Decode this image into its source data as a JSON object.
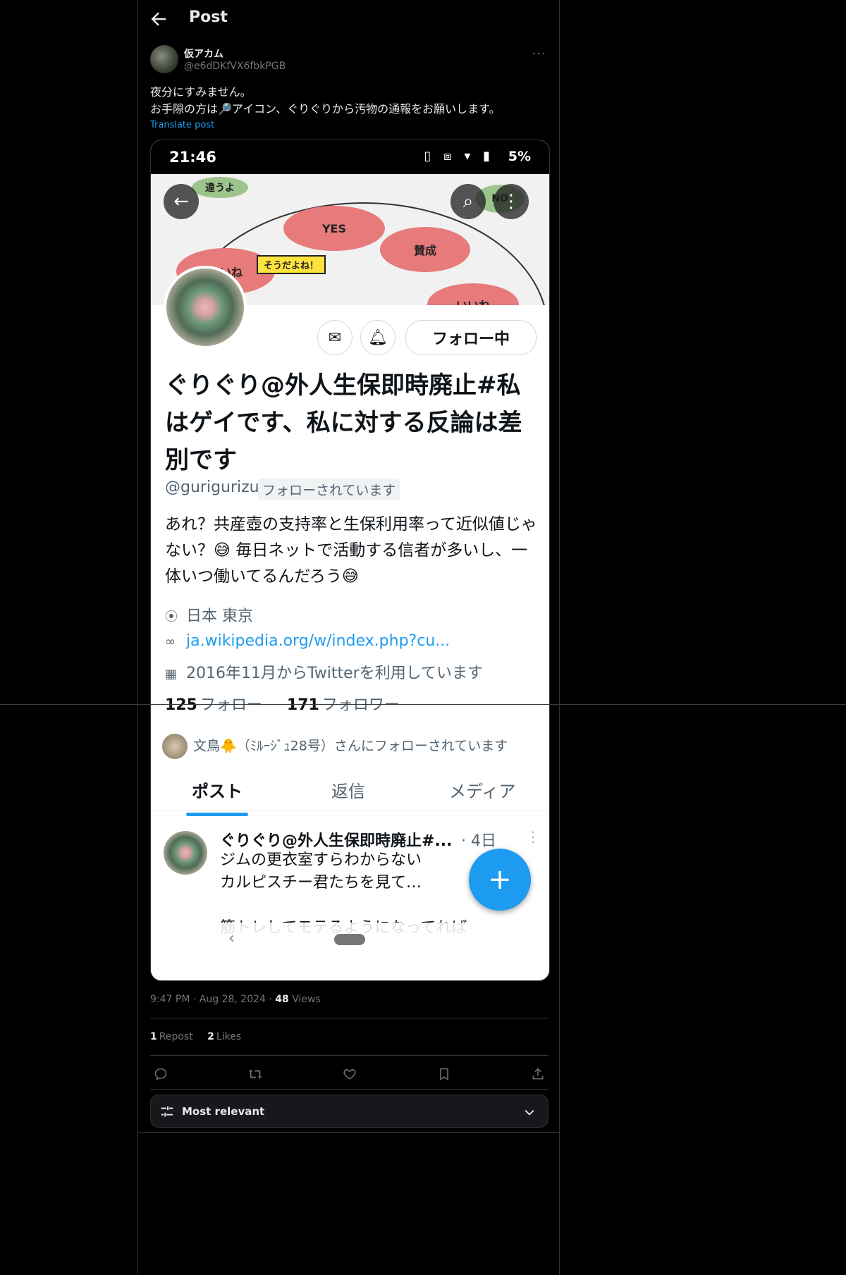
{
  "header": {
    "title": "Post"
  },
  "author": {
    "name": "仮アカム",
    "handle": "@e6dDKfVX6fbkPGB",
    "more": "···"
  },
  "post": {
    "line1": "夜分にすみません。",
    "line2": "お手隙の方は🔎アイコン、ぐりぐりから汚物の通報をお願いします。",
    "translate": "Translate post"
  },
  "screenshot": {
    "status_time": "21:46",
    "status_battery": "5%",
    "banner": {
      "oval_top": "違うよ",
      "oval_no": "NO",
      "oval_yes": "YES",
      "oval_agree": "賛成",
      "oval_left": "いいね",
      "oval_right": "いいね",
      "bubble": "そうだよね！"
    },
    "follow_button": "フォロー中",
    "profile_name": "ぐりぐり@外人生保即時廃止#私はゲイです、私に対する反論は差別です",
    "profile_handle": "@gurigurizu",
    "follows_you": "フォローされています",
    "bio": "あれ？共産壺の支持率と生保利用率って近似値じゃない？😅 毎日ネットで活動する信者が多いし、一体いつ働いてるんだろう😅",
    "location": "日本 東京",
    "link": "ja.wikipedia.org/w/index.php?cu...",
    "joined": "2016年11月からTwitterを利用しています",
    "following_count": "125",
    "following_label": "フォロー",
    "followers_count": "171",
    "followers_label": "フォロワー",
    "followed_by": "文鳥🐥（ﾐﾙｰｼﾞｭ28号）さんにフォローされています",
    "tabs": [
      "ポスト",
      "返信",
      "メディア"
    ],
    "tweet": {
      "name": "ぐりぐり@外人生保即時廃止#...",
      "time": "· 4日",
      "text": "ジムの更衣室すらわからない\nカルピスチー君たちを見て…\n\n筋トレしてモテるようになってれば"
    }
  },
  "meta": {
    "time": "9:47 PM",
    "date": "Aug 28, 2024",
    "views_count": "48",
    "views_label": "Views"
  },
  "stats": {
    "reposts_count": "1",
    "reposts_label": "Repost",
    "likes_count": "2",
    "likes_label": "Likes"
  },
  "sort": {
    "label": "Most relevant"
  },
  "colors": {
    "accent": "#1d9bf0",
    "background": "#000000",
    "text": "#e7e9ea",
    "muted": "#71767b"
  }
}
